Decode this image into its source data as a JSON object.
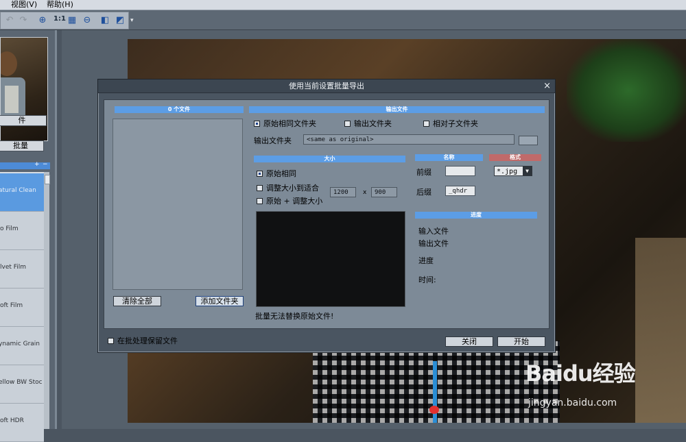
{
  "menubar": {
    "items": [
      "视图(V)",
      "帮助(H)"
    ]
  },
  "toolbar": {
    "items": [
      {
        "name": "undo-icon",
        "glyph": "↶",
        "state": "disabled"
      },
      {
        "name": "redo-icon",
        "glyph": "↷",
        "state": "disabled"
      },
      {
        "name": "zoom-in-icon",
        "glyph": "⊕"
      },
      {
        "name": "zoom-actual-label",
        "text": "1:1"
      },
      {
        "name": "fit-icon",
        "glyph": "▦"
      },
      {
        "name": "zoom-out-icon",
        "glyph": "⊖"
      },
      {
        "name": "compare-icon",
        "glyph": "◧"
      },
      {
        "name": "swap-icon",
        "glyph": "◩"
      }
    ],
    "zoom_actual": "1:1",
    "more_glyph": "▾"
  },
  "leftpanel": {
    "file_button": "件",
    "batch_button": "批量",
    "presets_header_icons": [
      "+",
      "−"
    ],
    "presets": [
      {
        "label": "atural Clean",
        "selected": true
      },
      {
        "label": "o Film",
        "selected": false
      },
      {
        "label": "lvet Film",
        "selected": false
      },
      {
        "label": "oft Film",
        "selected": false
      },
      {
        "label": "ynamic Grain",
        "selected": false
      },
      {
        "label": "ellow BW Stoc",
        "selected": false
      },
      {
        "label": "oft HDR",
        "selected": false
      }
    ]
  },
  "dialog": {
    "title": "使用当前设置批量导出",
    "close_glyph": "×",
    "files_header": "0 个文件",
    "clear_all": "清除全部",
    "add_folder": "添加文件夹",
    "output_header": "输出文件",
    "dest_options": [
      {
        "label": "原始相同文件夹",
        "selected": true
      },
      {
        "label": "输出文件夹",
        "selected": false
      },
      {
        "label": "相对子文件夹",
        "selected": false
      }
    ],
    "output_folder_label": "输出文件夹",
    "output_folder_value": "<same as original>",
    "size_header": "大小",
    "size_options": [
      {
        "label": "原始相同",
        "kind": "radio",
        "selected": true
      },
      {
        "label": "调整大小到适合",
        "kind": "check",
        "selected": false
      },
      {
        "label": "原始 + 调整大小",
        "kind": "check",
        "selected": false
      }
    ],
    "width": "1200",
    "times": "x",
    "height": "900",
    "name_header": "名称",
    "prefix_label": "前缀",
    "prefix_value": "",
    "suffix_label": "后缀",
    "suffix_value": "_qhdr",
    "format_header": "格式",
    "format_value": "*.jpg",
    "progress_header": "进度",
    "progress_labels": [
      "输入文件",
      "输出文件",
      "进度",
      "时间:"
    ],
    "warning": "批量无法替换原始文件!",
    "keep_files": "在批处理保留文件",
    "close_button": "关闭",
    "start_button": "开始"
  },
  "watermark": {
    "brand": "Baidu经验",
    "url": "jingyan.baidu.com"
  },
  "colors": {
    "accent_blue": "#5c9de5",
    "format_red": "#c06a6a",
    "dialog_bg": "#4a5561"
  }
}
